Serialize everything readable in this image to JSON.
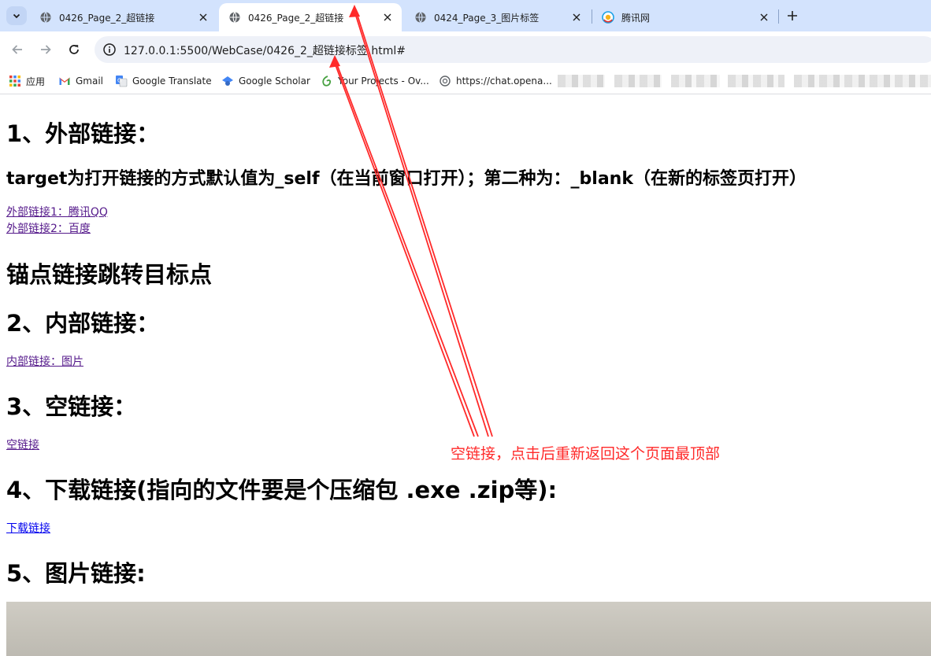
{
  "browser": {
    "tabs": [
      {
        "title": "0426_Page_2_超链接",
        "active": false,
        "icon": "globe-icon"
      },
      {
        "title": "0426_Page_2_超链接",
        "active": true,
        "icon": "globe-icon"
      },
      {
        "title": "0424_Page_3_图片标签",
        "active": false,
        "icon": "globe-icon"
      },
      {
        "title": "腾讯网",
        "active": false,
        "icon": "tencent-icon"
      }
    ],
    "url": "127.0.0.1:5500/WebCase/0426_2_超链接标签.html#",
    "bookmarks": [
      {
        "label": "应用",
        "icon": "apps-grid-icon"
      },
      {
        "label": "Gmail",
        "icon": "gmail-icon"
      },
      {
        "label": "Google Translate",
        "icon": "translate-icon"
      },
      {
        "label": "Google Scholar",
        "icon": "scholar-icon"
      },
      {
        "label": "Your Projects - Ov...",
        "icon": "overleaf-icon"
      },
      {
        "label": "https://chat.opena...",
        "icon": "openai-icon"
      }
    ]
  },
  "page": {
    "h1_external": "1、外部链接：",
    "h2_target": "target为打开链接的方式默认值为_self（在当前窗口打开）；第二种为：_blank（在新的标签页打开）",
    "link_ext1": "外部链接1：腾讯QQ",
    "link_ext2": "外部链接2：百度",
    "h1_anchor": "锚点链接跳转目标点",
    "h1_internal": "2、内部链接：",
    "link_internal": "内部链接：图片",
    "h1_empty": "3、空链接：",
    "link_empty": "空链接",
    "h1_download": "4、下载链接(指向的文件要是个压缩包 .exe .zip等):",
    "link_download": "下载链接",
    "h1_image": "5、图片链接:"
  },
  "annotation": {
    "text": "空链接，点击后重新返回这个页面最顶部",
    "color": "#ff2a2a"
  },
  "colors": {
    "tabstrip": "#d3e3fd",
    "visited_link": "#551a8b",
    "link": "#0000ee"
  }
}
